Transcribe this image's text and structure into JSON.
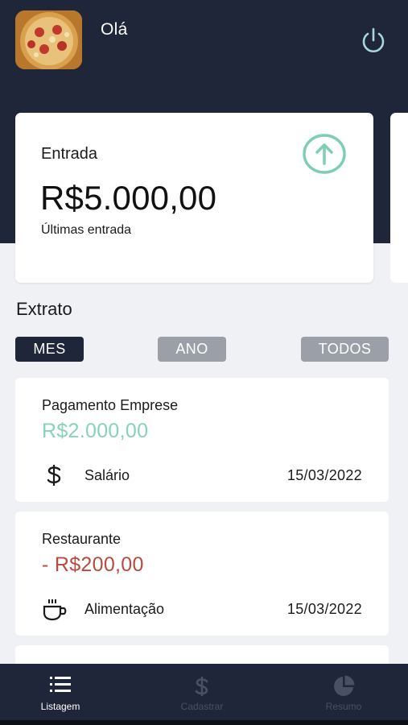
{
  "header": {
    "greeting": "Olá",
    "avatar_icon": "pizza-avatar",
    "power_icon": "power-icon",
    "background": "#1f2639"
  },
  "balance_card": {
    "title": "Entrada",
    "amount": "R$5.000,00",
    "subtitle": "Últimas entrada",
    "icon": "arrow-up-circle-icon",
    "icon_color": "#7dcfb0"
  },
  "statement": {
    "title": "Extrato",
    "filters": [
      {
        "label": "MES",
        "active": true
      },
      {
        "label": "ANO",
        "active": false
      },
      {
        "label": "TODOS",
        "active": false
      }
    ]
  },
  "transactions": [
    {
      "name": "Pagamento Emprese",
      "value": "R$2.000,00",
      "type": "income",
      "color": "#86d3b6",
      "category": "Salário",
      "category_icon": "dollar-icon",
      "date": "15/03/2022"
    },
    {
      "name": "Restaurante",
      "value": "- R$200,00",
      "type": "expense",
      "color": "#b94a3e",
      "category": "Alimentação",
      "category_icon": "coffee-icon",
      "date": "15/03/2022"
    }
  ],
  "bottom_nav": {
    "items": [
      {
        "label": "Listagem",
        "icon": "list-icon",
        "active": true
      },
      {
        "label": "Cadastrar",
        "icon": "dollar-icon",
        "active": false
      },
      {
        "label": "Resumo",
        "icon": "pie-chart-icon",
        "active": false
      }
    ],
    "active_color": "#ffffff",
    "inactive_color": "#4a5064"
  }
}
